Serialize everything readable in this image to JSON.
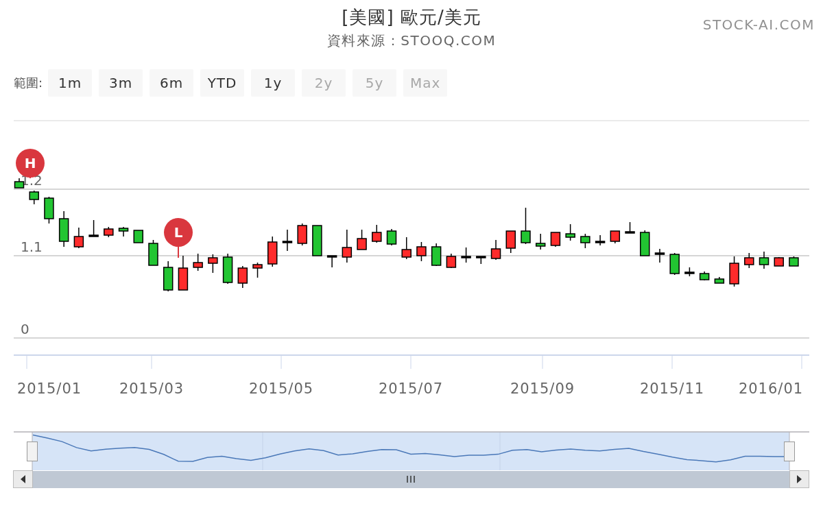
{
  "header": {
    "title": "[美國] 歐元/美元",
    "subtitle": "資料來源：STOOQ.COM",
    "credit": "STOCK-AI.COM"
  },
  "range_selector": {
    "label": "範圍:",
    "buttons": [
      {
        "label": "1m",
        "disabled": false
      },
      {
        "label": "3m",
        "disabled": false
      },
      {
        "label": "6m",
        "disabled": false
      },
      {
        "label": "YTD",
        "disabled": false
      },
      {
        "label": "1y",
        "disabled": false
      },
      {
        "label": "2y",
        "disabled": true
      },
      {
        "label": "5y",
        "disabled": true
      },
      {
        "label": "Max",
        "disabled": true
      }
    ]
  },
  "chart": {
    "y_axis_labels": [
      "1.2",
      "1.1",
      "0"
    ],
    "x_axis_labels": [
      "2015/01",
      "2015/03",
      "2015/05",
      "2015/07",
      "2015/09",
      "2015/11",
      "2016/01"
    ],
    "flags": [
      {
        "label": "H"
      },
      {
        "label": "L"
      }
    ]
  }
}
